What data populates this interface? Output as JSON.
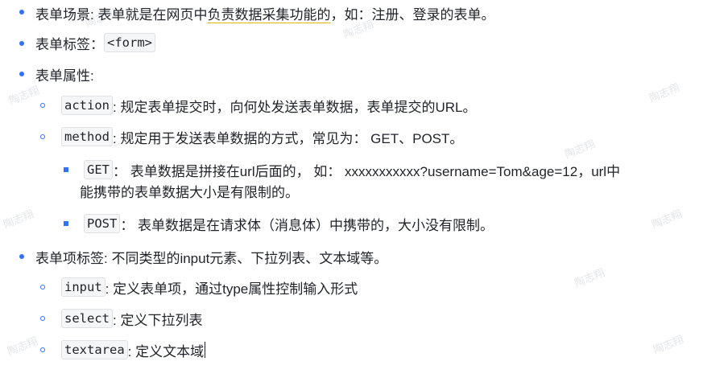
{
  "watermark": "陶志翔",
  "items": {
    "scene": {
      "label": "表单场景: 表单就是在网页中",
      "underlined": "负责数据采集功能的",
      "rest": "，如：注册、登录的表单。"
    },
    "tag": {
      "label": "表单标签：",
      "code": "<form>"
    },
    "attrs": {
      "label": "表单属性:"
    },
    "action": {
      "code": "action",
      "text": ": 规定表单提交时，向何处发送表单数据，表单提交的URL。"
    },
    "method": {
      "code": "method",
      "text": ": 规定用于发送表单数据的方式，常见为： GET、POST。"
    },
    "get": {
      "code": "GET",
      "text": "： 表单数据是拼接在url后面的， 如： xxxxxxxxxxx?username=Tom&age=12，url中",
      "text2": "能携带的表单数据大小是有限制的。"
    },
    "post": {
      "code": "POST",
      "text": "： 表单数据是在请求体（消息体）中携带的，大小没有限制。"
    },
    "items_tag": {
      "label": "表单项标签: 不同类型的input元素、下拉列表、文本域等。"
    },
    "input": {
      "code": "input",
      "text": ": 定义表单项，通过type属性控制输入形式"
    },
    "select": {
      "code": "select",
      "text": ": 定义下拉列表"
    },
    "textarea": {
      "code": "textarea",
      "text": ": 定义文本域"
    }
  }
}
